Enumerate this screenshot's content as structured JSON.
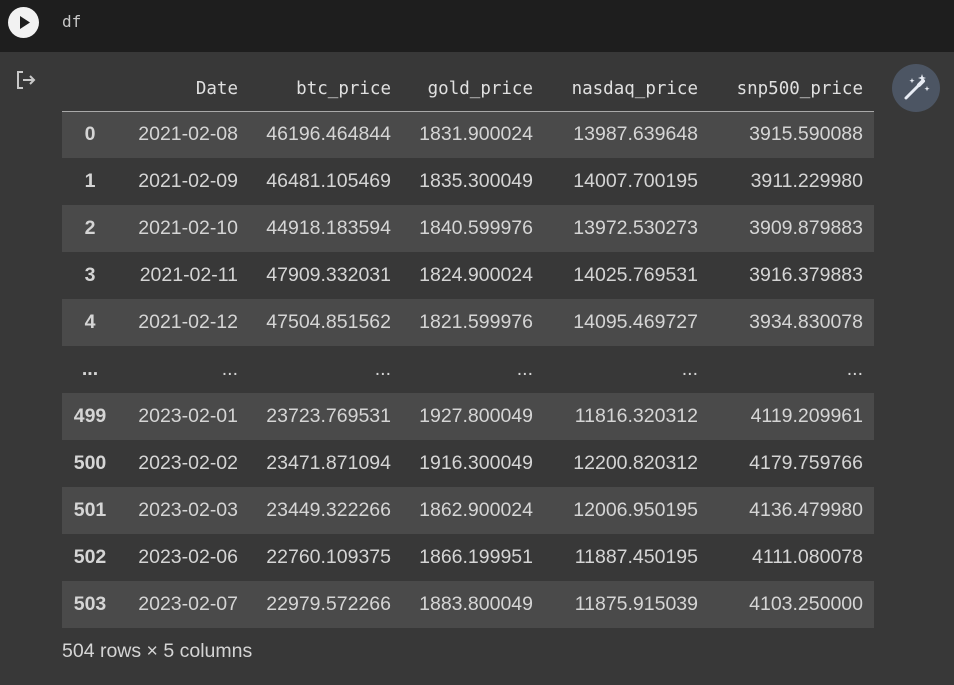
{
  "code_cell": {
    "source": "df"
  },
  "table": {
    "columns": [
      "",
      "Date",
      "btc_price",
      "gold_price",
      "nasdaq_price",
      "snp500_price"
    ],
    "rows": [
      [
        "0",
        "2021-02-08",
        "46196.464844",
        "1831.900024",
        "13987.639648",
        "3915.590088"
      ],
      [
        "1",
        "2021-02-09",
        "46481.105469",
        "1835.300049",
        "14007.700195",
        "3911.229980"
      ],
      [
        "2",
        "2021-02-10",
        "44918.183594",
        "1840.599976",
        "13972.530273",
        "3909.879883"
      ],
      [
        "3",
        "2021-02-11",
        "47909.332031",
        "1824.900024",
        "14025.769531",
        "3916.379883"
      ],
      [
        "4",
        "2021-02-12",
        "47504.851562",
        "1821.599976",
        "14095.469727",
        "3934.830078"
      ],
      [
        "...",
        "...",
        "...",
        "...",
        "...",
        "..."
      ],
      [
        "499",
        "2023-02-01",
        "23723.769531",
        "1927.800049",
        "11816.320312",
        "4119.209961"
      ],
      [
        "500",
        "2023-02-02",
        "23471.871094",
        "1916.300049",
        "12200.820312",
        "4179.759766"
      ],
      [
        "501",
        "2023-02-03",
        "23449.322266",
        "1862.900024",
        "12006.950195",
        "4136.479980"
      ],
      [
        "502",
        "2023-02-06",
        "22760.109375",
        "1866.199951",
        "11887.450195",
        "4111.080078"
      ],
      [
        "503",
        "2023-02-07",
        "22979.572266",
        "1883.800049",
        "11875.915039",
        "4103.250000"
      ]
    ],
    "shape_text": "504 rows × 5 columns"
  },
  "icons": {
    "run": "play-icon",
    "output": "output-exit-icon",
    "magic": "magic-wand-icon"
  },
  "colors": {
    "code_bg": "#1e1e1e",
    "output_bg": "#383838",
    "stripe_bg": "#4a4a4a",
    "magic_button_bg": "#4c5563"
  }
}
